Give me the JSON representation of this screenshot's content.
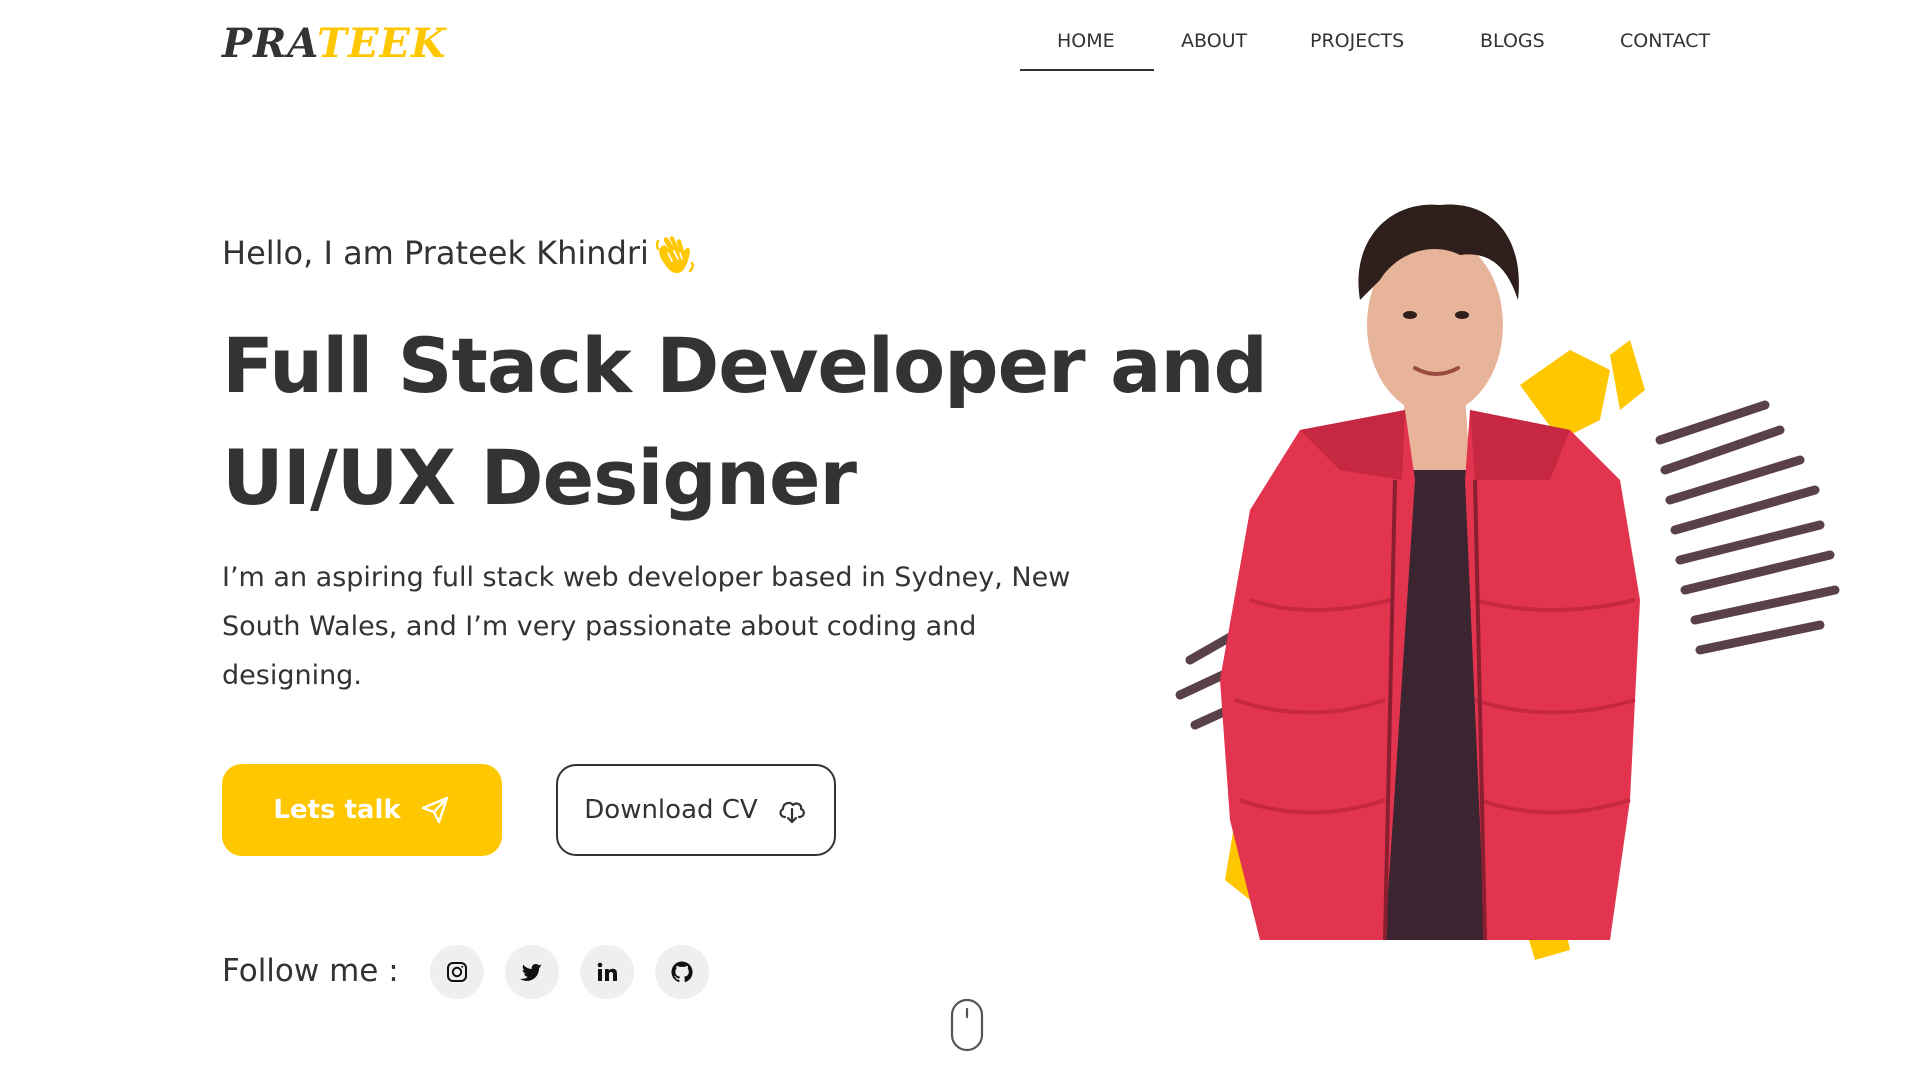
{
  "brand": {
    "logo_part1": "PRA",
    "logo_part2": "TEEK",
    "accent_color": "#FFC700",
    "text_color": "#333333"
  },
  "nav": {
    "items": [
      {
        "label": "HOME",
        "active": true
      },
      {
        "label": "ABOUT",
        "active": false
      },
      {
        "label": "PROJECTS",
        "active": false
      },
      {
        "label": "BLOGS",
        "active": false
      },
      {
        "label": "CONTACT",
        "active": false
      }
    ]
  },
  "hero": {
    "greeting": "Hello, I am Prateek Khindri",
    "greeting_icon": "waving-hand-icon",
    "headline_line1": "Full Stack Developer and",
    "headline_line2": "UI/UX Designer",
    "intro": "I’m an aspiring full stack web developer based in Sydney, New South Wales, and I’m very passionate about coding and designing.",
    "primary_button": {
      "label": "Lets talk",
      "icon": "send-icon"
    },
    "secondary_button": {
      "label": "Download CV",
      "icon": "cloud-download-icon"
    }
  },
  "social": {
    "label": "Follow me :",
    "links": [
      {
        "icon": "instagram-icon"
      },
      {
        "icon": "twitter-icon"
      },
      {
        "icon": "linkedin-icon"
      },
      {
        "icon": "github-icon"
      }
    ]
  },
  "scroll_indicator": {
    "icon": "mouse-scroll-icon"
  },
  "portrait": {
    "jacket_color": "#E3344F",
    "splash_yellow": "#FFC700",
    "splash_dark": "#5A4048"
  }
}
